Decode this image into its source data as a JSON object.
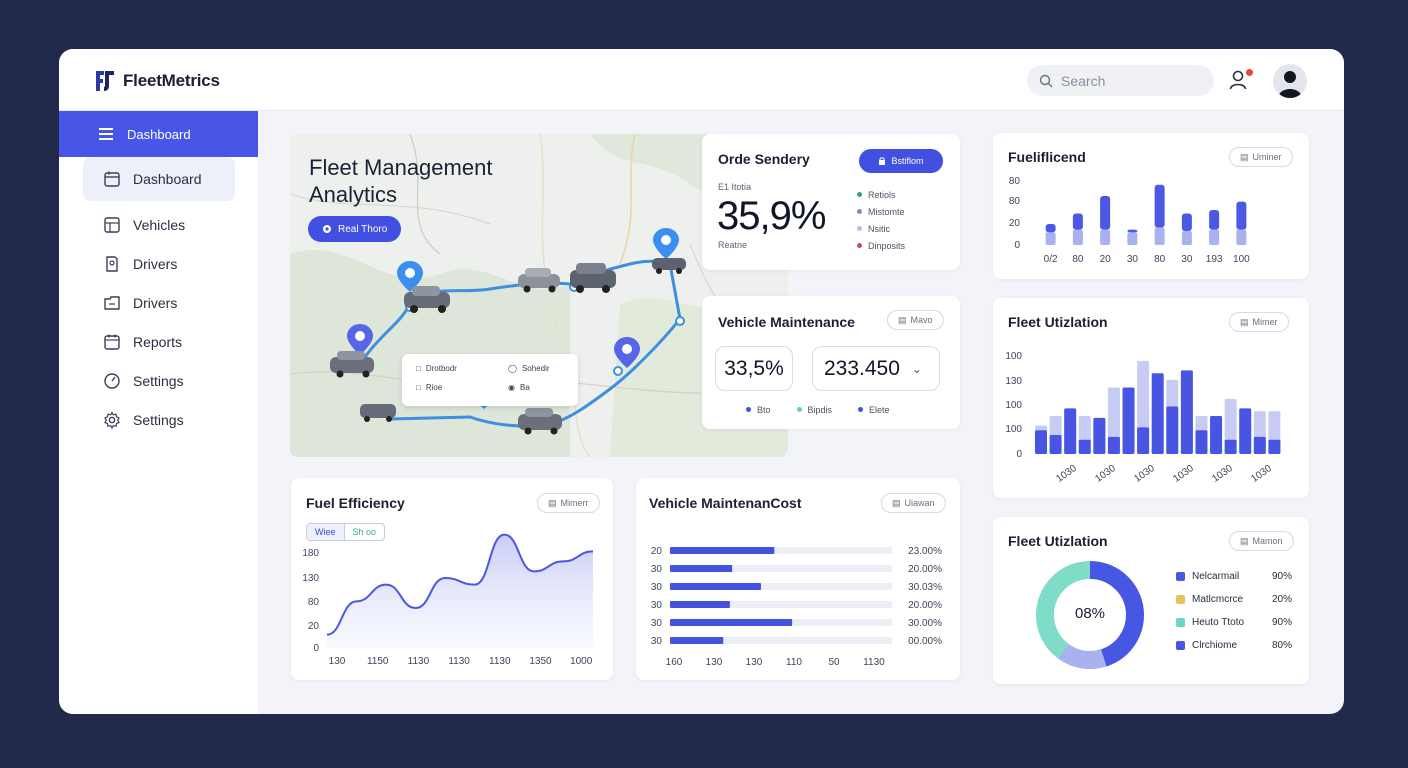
{
  "app": {
    "name": "FleetMetrics"
  },
  "search": {
    "placeholder": "Search"
  },
  "sidebar": {
    "active": "Dashboard",
    "items": [
      {
        "label": "Dashboard",
        "icon": "calendar-icon"
      },
      {
        "label": "Vehicles",
        "icon": "grid-icon"
      },
      {
        "label": "Drivers",
        "icon": "id-card-icon"
      },
      {
        "label": "Drivers",
        "icon": "folder-icon"
      },
      {
        "label": "Reports",
        "icon": "report-icon"
      },
      {
        "label": "Settings",
        "icon": "gauge-icon"
      },
      {
        "label": "Settings",
        "icon": "gear-icon"
      }
    ]
  },
  "map": {
    "title_line1": "Fleet Management",
    "title_line2": "Analytics",
    "button": "Real Thoro",
    "popup": {
      "a": "Drotbodr",
      "b": "Sohedir",
      "c": "Rioe",
      "d": "Ba"
    }
  },
  "order_card": {
    "title": "Orde Sendery",
    "button": "Bstiflom",
    "sub_top": "E1 Itotia",
    "value": "35,9%",
    "sub_bottom": "Reatne",
    "legend": [
      {
        "label": "Retiols",
        "color": "#3aa36a"
      },
      {
        "label": "Mistomte",
        "color": "#9b7cc8"
      },
      {
        "label": "Nsitic",
        "color": "#b8c0e8"
      },
      {
        "label": "Dinposits",
        "color": "#b4526a"
      }
    ]
  },
  "maint_card": {
    "title": "Vehicle Maintenance",
    "pill": "Mavo",
    "value1": "33,5%",
    "value2": "233.450",
    "legend": [
      {
        "label": "Bto",
        "color": "#4350d8"
      },
      {
        "label": "Bipdis",
        "color": "#5fd1b6"
      },
      {
        "label": "Elete",
        "color": "#4350d8"
      }
    ]
  },
  "fuel_trend": {
    "title": "Fueliflicend",
    "pill": "Uminer"
  },
  "fleet_util_bar": {
    "title": "Fleet Utizlation",
    "pill": "Mimer"
  },
  "fuel_eff": {
    "title": "Fuel Efficiency",
    "pill": "Mimerr",
    "tab1": "Wiee",
    "tab2": "Sh oo"
  },
  "maint_cost": {
    "title": "Vehicle MaintenanCost",
    "pill": "Uiawan"
  },
  "fleet_util_donut": {
    "title": "Fleet Utizlation",
    "pill": "Mamon",
    "center": "08%",
    "legend": [
      {
        "label": "Nelcarmail",
        "value": "90%",
        "color": "#4557e3"
      },
      {
        "label": "Matlcmcrce",
        "value": "20%",
        "color": "#e8c25a"
      },
      {
        "label": "Heuto Ttoto",
        "value": "90%",
        "color": "#6cd6c2"
      },
      {
        "label": "Clrchiome",
        "value": "80%",
        "color": "#4557e3"
      }
    ]
  },
  "chart_data": [
    {
      "type": "bar",
      "name_ref": "fuel_trend",
      "categories": [
        "0/2",
        "80",
        "20",
        "30",
        "80",
        "30",
        "193",
        "100"
      ],
      "series": [
        {
          "values": [
            30,
            45,
            70,
            22,
            86,
            45,
            50,
            62
          ]
        },
        {
          "values": [
            18,
            22,
            22,
            18,
            25,
            20,
            22,
            22
          ]
        }
      ],
      "yticks": [
        "0",
        "20",
        "80",
        "80"
      ],
      "ylim": [
        0,
        100
      ]
    },
    {
      "type": "bar",
      "name_ref": "fleet_util_bar",
      "xticks": [
        "1030",
        "1030",
        "1030",
        "1030",
        "1030",
        "1030"
      ],
      "series": [
        {
          "values": [
            25,
            20,
            48,
            15,
            38,
            18,
            70,
            28,
            85,
            50,
            88,
            25,
            40,
            15,
            48,
            18,
            15
          ]
        },
        {
          "values": [
            30,
            40,
            30,
            40,
            35,
            70,
            40,
            98,
            45,
            78,
            40,
            40,
            25,
            58,
            30,
            45,
            45
          ]
        }
      ],
      "yticks": [
        "0",
        "100",
        "100",
        "130",
        "100"
      ]
    },
    {
      "type": "area",
      "name_ref": "fuel_eff",
      "x": [
        "130",
        "1150",
        "1130",
        "1130",
        "1130",
        "1350",
        "1000"
      ],
      "y": [
        20,
        70,
        95,
        60,
        105,
        95,
        170,
        115,
        130,
        145
      ],
      "yticks": [
        "0",
        "20",
        "80",
        "130",
        "180"
      ]
    },
    {
      "type": "bar",
      "name_ref": "maint_cost",
      "orientation": "horizontal",
      "rows": [
        {
          "label": "20",
          "value": 47,
          "right": "23.00%"
        },
        {
          "label": "30",
          "value": 28,
          "right": "20.00%"
        },
        {
          "label": "30",
          "value": 41,
          "right": "30.03%"
        },
        {
          "label": "30",
          "value": 27,
          "right": "20.00%"
        },
        {
          "label": "30",
          "value": 55,
          "right": "30.00%"
        },
        {
          "label": "30",
          "value": 24,
          "right": "00.00%"
        }
      ],
      "xticks": [
        "160",
        "130",
        "130",
        "110",
        "50",
        "1130"
      ]
    },
    {
      "type": "pie",
      "name_ref": "fleet_util_donut",
      "slices": [
        {
          "value": 45,
          "color": "#4557e3"
        },
        {
          "value": 15,
          "color": "#a9b1ee"
        },
        {
          "value": 40,
          "color": "#7fdcc8"
        }
      ]
    }
  ]
}
